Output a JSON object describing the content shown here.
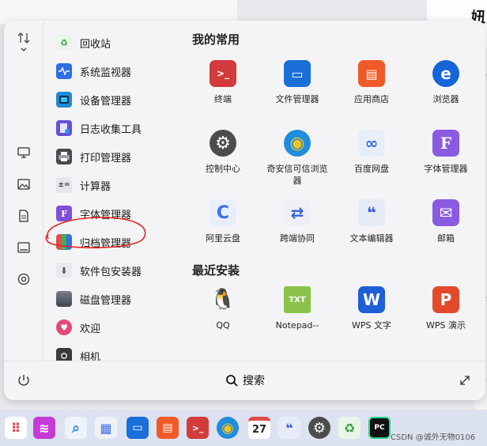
{
  "background": {
    "right_char": "妞"
  },
  "sidebar": {
    "icons": [
      "sort-icon",
      "monitor-icon",
      "picture-icon",
      "document-icon",
      "window-icon",
      "settings-icon"
    ]
  },
  "app_list": {
    "items": [
      {
        "label": "回收站",
        "icon": "recycle-bin-icon",
        "color": "#e9f5e9"
      },
      {
        "label": "系统监视器",
        "icon": "system-monitor-icon",
        "color": "#2f6ee6"
      },
      {
        "label": "设备管理器",
        "icon": "device-manager-icon",
        "color": "#1f8bd6"
      },
      {
        "label": "日志收集工具",
        "icon": "log-collector-icon",
        "color": "#6a4fd6"
      },
      {
        "label": "打印管理器",
        "icon": "printer-icon",
        "color": "#4a4a4a"
      },
      {
        "label": "计算器",
        "icon": "calculator-icon",
        "color": "#e4e6ec"
      },
      {
        "label": "字体管理器",
        "icon": "font-manager-icon",
        "color": "#7c4fd8"
      },
      {
        "label": "归档管理器",
        "icon": "archive-manager-icon",
        "color": "#7a5bd0"
      },
      {
        "label": "软件包安装器",
        "icon": "package-installer-icon",
        "color": "#e6e8ee"
      },
      {
        "label": "磁盘管理器",
        "icon": "disk-manager-icon",
        "color": "#555a63"
      },
      {
        "label": "欢迎",
        "icon": "welcome-icon",
        "color": "#e04a78"
      },
      {
        "label": "相机",
        "icon": "camera-icon",
        "color": "#3a3a3a"
      }
    ]
  },
  "favorites": {
    "title": "我的常用",
    "items": [
      {
        "label": "终端",
        "color": "#d23b3b",
        "glyph": ">_"
      },
      {
        "label": "文件管理器",
        "color": "#1a6fd9",
        "glyph": "▭"
      },
      {
        "label": "应用商店",
        "color": "#f05a28",
        "glyph": "▤"
      },
      {
        "label": "浏览器",
        "color": "#1565d8",
        "glyph": "e"
      },
      {
        "label": "控制中心",
        "color": "#4d4d4d",
        "glyph": "⚙"
      },
      {
        "label": "奇安信可信浏览器",
        "color": "#1f8de0",
        "glyph": "◉"
      },
      {
        "label": "百度网盘",
        "color": "#e8eef8",
        "glyph": "∞"
      },
      {
        "label": "字体管理器",
        "color": "#8a5be0",
        "glyph": "F"
      },
      {
        "label": "阿里云盘",
        "color": "#e8eefb",
        "glyph": "C"
      },
      {
        "label": "跨端协同",
        "color": "#eef0f6",
        "glyph": "⇄"
      },
      {
        "label": "文本编辑器",
        "color": "#e6ebf5",
        "glyph": "❝"
      },
      {
        "label": "邮箱",
        "color": "#8a5be0",
        "glyph": "✉"
      }
    ]
  },
  "recent": {
    "title": "最近安装",
    "items": [
      {
        "label": "QQ",
        "color": "#ffffff",
        "glyph": "🐧"
      },
      {
        "label": "Notepad--",
        "color": "#8bc34a",
        "glyph": "TXT"
      },
      {
        "label": "WPS 文字",
        "color": "#1e5fd8",
        "glyph": "W"
      },
      {
        "label": "WPS 演示",
        "color": "#e24a2a",
        "glyph": "P"
      }
    ]
  },
  "bottom": {
    "search_label": "搜索"
  },
  "taskbar": {
    "icons": [
      {
        "name": "launcher-grid-icon",
        "color": "#ffffff",
        "glyph": "⠿"
      },
      {
        "name": "multitask-icon",
        "color": "#c43bd8",
        "glyph": "≋"
      },
      {
        "name": "search-icon",
        "color": "#2f8be0",
        "glyph": "⌕"
      },
      {
        "name": "control-center-icon",
        "color": "#3e6fe0",
        "glyph": "▦"
      },
      {
        "name": "file-manager-icon",
        "color": "#1a6fd9",
        "glyph": "▭"
      },
      {
        "name": "app-store-icon",
        "color": "#f05a28",
        "glyph": "▤"
      },
      {
        "name": "terminal-icon",
        "color": "#d23b3b",
        "glyph": ">_"
      },
      {
        "name": "qianxin-browser-icon",
        "color": "#1f8de0",
        "glyph": "◉"
      },
      {
        "name": "calendar-icon",
        "color": "#ffffff",
        "glyph": "27"
      },
      {
        "name": "text-editor-icon",
        "color": "#e6ebf5",
        "glyph": "❝"
      },
      {
        "name": "settings-icon",
        "color": "#4d4d4d",
        "glyph": "⚙"
      },
      {
        "name": "recycle-bin-icon",
        "color": "#e9f5e9",
        "glyph": "♻"
      },
      {
        "name": "pycharm-icon",
        "color": "#21d789",
        "glyph": "PC"
      }
    ],
    "watermark": "CSDN @诚外无物0106"
  },
  "annotation_color": "#e8231e"
}
